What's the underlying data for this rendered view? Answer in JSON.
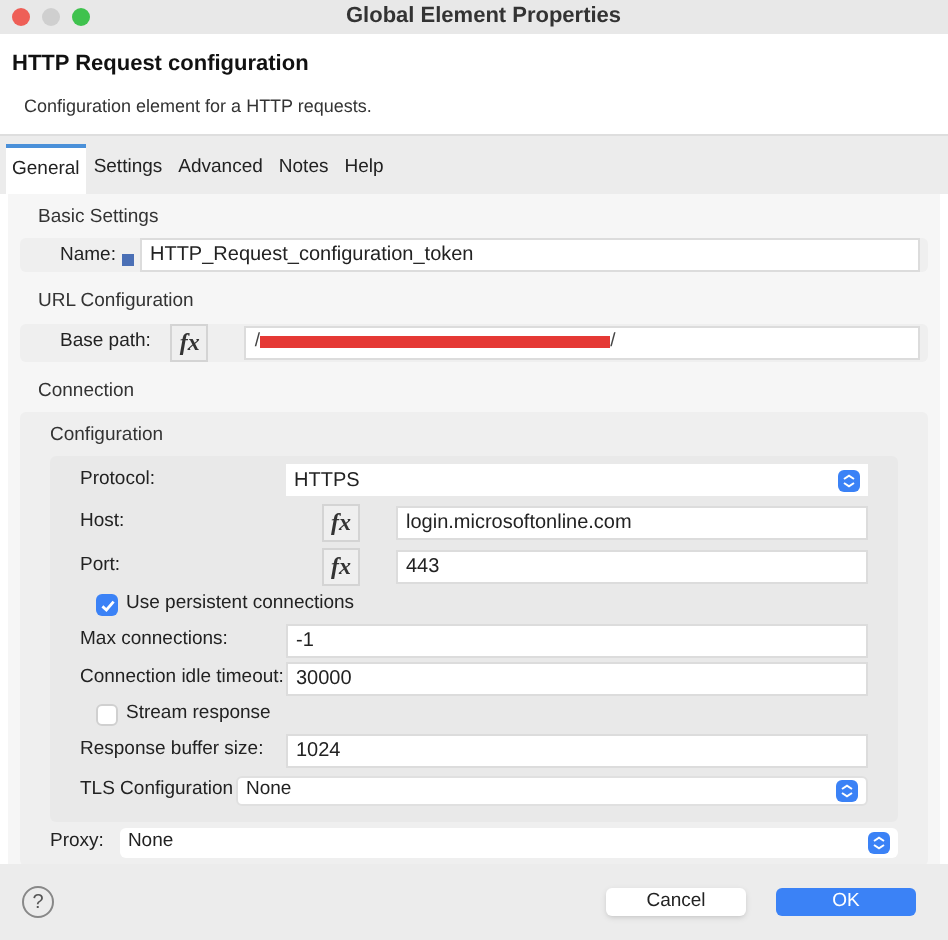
{
  "window": {
    "title": "Global Element Properties"
  },
  "header": {
    "title": "HTTP Request configuration",
    "description": "Configuration element for a HTTP requests."
  },
  "tabs": [
    {
      "label": "General",
      "selected": true
    },
    {
      "label": "Settings",
      "selected": false
    },
    {
      "label": "Advanced",
      "selected": false
    },
    {
      "label": "Notes",
      "selected": false
    },
    {
      "label": "Help",
      "selected": false
    }
  ],
  "basic_settings": {
    "title": "Basic Settings",
    "name_label": "Name:",
    "name_value": "HTTP_Request_configuration_token"
  },
  "url_configuration": {
    "title": "URL Configuration",
    "base_path_label": "Base path:",
    "fx": "fx",
    "value_start": "/",
    "redacted": true,
    "value_end": "/"
  },
  "connection": {
    "title": "Connection",
    "configuration": {
      "title": "Configuration",
      "rows": [
        {
          "kind": "select",
          "label": "Protocol:",
          "value": "HTTPS"
        },
        {
          "kind": "fx",
          "label": "Host:",
          "fx": "fx",
          "value": "login.microsoftonline.com"
        },
        {
          "kind": "fx",
          "label": "Port:",
          "fx": "fx",
          "value": "443"
        },
        {
          "kind": "checkbox",
          "label": "Use persistent connections",
          "checked": true
        },
        {
          "kind": "field",
          "label": "Max connections:",
          "value": "-1"
        },
        {
          "kind": "field",
          "label": "Connection idle timeout:",
          "value": "30000"
        },
        {
          "kind": "checkbox",
          "label": "Stream response",
          "checked": false
        },
        {
          "kind": "field",
          "label": "Response buffer size:",
          "value": "1024"
        },
        {
          "kind": "tls",
          "label": "TLS Configuration",
          "value": "None"
        }
      ]
    },
    "proxy": {
      "label": "Proxy:",
      "value": "None"
    }
  },
  "footer": {
    "help": "?",
    "buttons": [
      {
        "label": "Cancel",
        "kind": "secondary"
      },
      {
        "label": "OK",
        "kind": "primary"
      }
    ]
  }
}
